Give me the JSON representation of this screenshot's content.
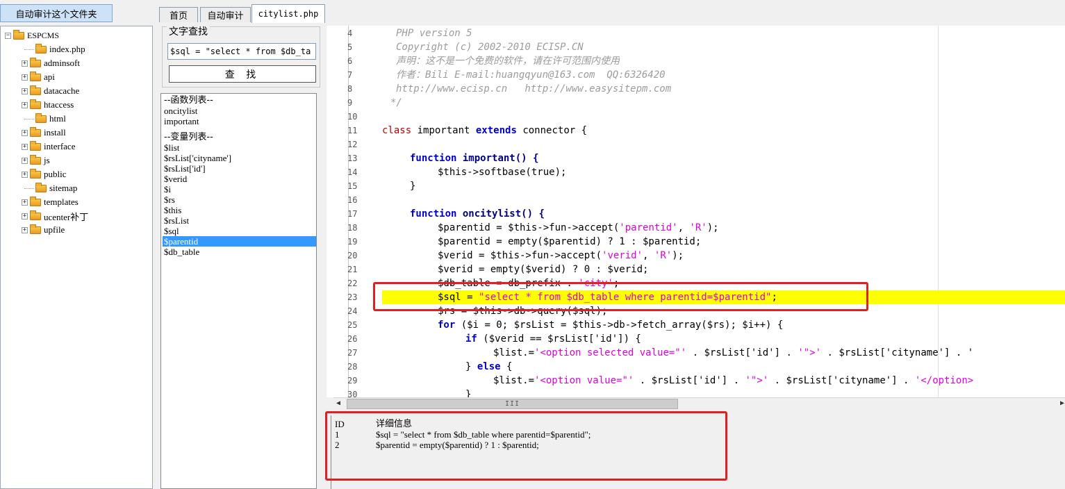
{
  "left_panel": {
    "audit_button": "自动审计这个文件夹",
    "tree": {
      "root": "ESPCMS",
      "items": [
        {
          "label": "index.php",
          "expandable": false
        },
        {
          "label": "adminsoft",
          "expandable": true
        },
        {
          "label": "api",
          "expandable": true
        },
        {
          "label": "datacache",
          "expandable": true
        },
        {
          "label": "htaccess",
          "expandable": true
        },
        {
          "label": "html",
          "expandable": false
        },
        {
          "label": "install",
          "expandable": true
        },
        {
          "label": "interface",
          "expandable": true
        },
        {
          "label": "js",
          "expandable": true
        },
        {
          "label": "public",
          "expandable": true
        },
        {
          "label": "sitemap",
          "expandable": false
        },
        {
          "label": "templates",
          "expandable": true
        },
        {
          "label": "ucenter补丁",
          "expandable": true
        },
        {
          "label": "upfile",
          "expandable": true
        }
      ]
    }
  },
  "tabs": [
    {
      "label": "首页",
      "active": false
    },
    {
      "label": "自动审计",
      "active": false
    },
    {
      "label": "citylist.php",
      "active": true
    }
  ],
  "search": {
    "legend": "文字查找",
    "value": "$sql = \"select * from $db_ta",
    "button": "查 找"
  },
  "symbols": {
    "func_header": "--函数列表--",
    "functions": [
      "oncitylist",
      "important"
    ],
    "var_header": "--变量列表--",
    "variables": [
      "$list",
      "$rsList['cityname']",
      "$rsList['id']",
      "$verid",
      "$i",
      "$rs",
      "$this",
      "$rsList",
      "$sql",
      "$parentid",
      "$db_table"
    ],
    "selected": "$parentid"
  },
  "editor": {
    "line_numbers": [
      "4",
      "5",
      "6",
      "7",
      "8",
      "9",
      "10",
      "11",
      "12",
      "13",
      "14",
      "15",
      "16",
      "17",
      "18",
      "19",
      "20",
      "21",
      "22",
      "23",
      "24",
      "25",
      "26",
      "27",
      "28",
      "29",
      "30"
    ],
    "lines": {
      "l4": "PHP version 5",
      "l5": "Copyright (c) 2002-2010 ECISP.CN",
      "l6": "声明：这不是一个免费的软件，请在许可范围内使用",
      "l7": "作者：Bili E-mail:huangqyun@163.com  QQ:6326420",
      "l8": "http://www.ecisp.cn   http://www.easysitepm.com",
      "l9": "*/",
      "l11_kw": "class",
      "l11_name": " important ",
      "l11_ext": "extends",
      "l11_rest": " connector {",
      "l13_kw": "function",
      "l13_name": " important() {",
      "l14": "$this->softbase(true);",
      "l15": "}",
      "l17_kw": "function",
      "l17_name": " oncitylist() {",
      "l18_a": "$parentid = $this->fun->accept(",
      "l18_s1": "'parentid'",
      "l18_b": ", ",
      "l18_s2": "'R'",
      "l18_c": ");",
      "l19": "$parentid = empty($parentid) ? 1 : $parentid;",
      "l20_a": "$verid = $this->fun->accept(",
      "l20_s1": "'verid'",
      "l20_b": ", ",
      "l20_s2": "'R'",
      "l20_c": ");",
      "l21": "$verid = empty($verid) ? 0 : $verid;",
      "l22_a": "$db_table = db_prefix . ",
      "l22_s": "'city'",
      "l22_c": ";",
      "l23_a": "$sql = ",
      "l23_s": "\"select * from $db_table where parentid=$parentid\"",
      "l23_c": ";",
      "l24": "$rs = $this->db->query($sql);",
      "l25_kw": "for",
      "l25_rest": " ($i = 0; $rsList = $this->db->fetch_array($rs); $i++) {",
      "l26_kw": "if",
      "l26_rest": " ($verid == $rsList['id']) {",
      "l27_a": "$list.=",
      "l27_s": "'<option selected value=\"'",
      "l27_b": " . $rsList['id'] . ",
      "l27_s2": "'\">'",
      "l27_c": " . $rsList['cityname'] . '",
      "l28_a": "} ",
      "l28_kw": "else",
      "l28_b": " {",
      "l29_a": "$list.=",
      "l29_s": "'<option value=\"'",
      "l29_b": " . $rsList['id'] . ",
      "l29_s2": "'\">'",
      "l29_c": " . $rsList['cityname'] . ",
      "l29_s3": "'</option>",
      "l30": "}"
    }
  },
  "scrollbar_grip": "III",
  "results": {
    "col_id": "ID",
    "col_detail": "详细信息",
    "rows": [
      {
        "id": "1",
        "detail": "$sql = \"select * from $db_table where parentid=$parentid\";"
      },
      {
        "id": "2",
        "detail": "$parentid = empty($parentid) ? 1 : $parentid;"
      }
    ]
  },
  "colors": {
    "highlight": "#ffff00",
    "annotation": "#e02020",
    "selection": "#3399ff"
  }
}
